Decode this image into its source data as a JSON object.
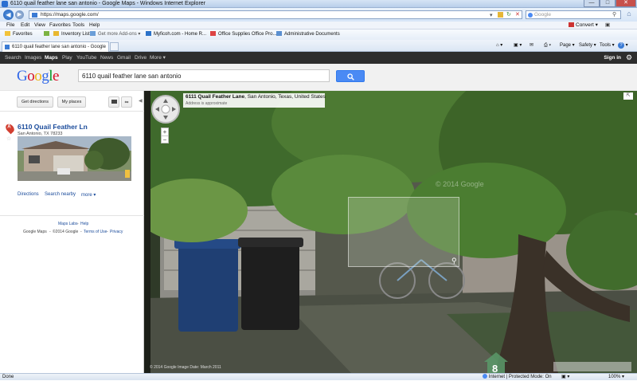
{
  "window": {
    "title": "6110 quail feather lane san antonio - Google Maps - Windows Internet Explorer"
  },
  "address_bar": {
    "url": "https://maps.google.com/",
    "search_placeholder": "Google",
    "convert_label": "Convert"
  },
  "menu": [
    "File",
    "Edit",
    "View",
    "Favorites",
    "Tools",
    "Help"
  ],
  "favorites_bar": {
    "favorites_label": "Favorites",
    "links": [
      "Inventory List",
      "Get more Add-ons",
      "Myficoh.com - Home R...",
      "Office Supplies Office Pro...",
      "Administrative Documents"
    ]
  },
  "tab": {
    "title": "6110 quail feather lane san antonio - Google Maps"
  },
  "command_bar": [
    "Page",
    "Safety",
    "Tools"
  ],
  "google_bar": {
    "items": [
      "Search",
      "Images",
      "Maps",
      "Play",
      "YouTube",
      "News",
      "Gmail",
      "Drive",
      "More"
    ],
    "active": "Maps",
    "signin": "Sign in"
  },
  "search": {
    "logo": "Google",
    "query": "6110 quail feather lane san antonio"
  },
  "left_panel": {
    "get_directions": "Get directions",
    "my_places": "My places",
    "result": {
      "marker": "A",
      "title": "6110 Quail Feather Ln",
      "address": "San Antonio, TX 78233"
    },
    "links": [
      "Directions",
      "Search nearby",
      "more"
    ],
    "footer_links": [
      "Maps Labs",
      "Help"
    ],
    "footer": {
      "prefix": "Google Maps",
      "copyright": "©2014 Google",
      "terms": "Terms of Use",
      "privacy": "Privacy"
    }
  },
  "street_view": {
    "address_main": "6111 Quail Feather Lane",
    "address_rest": ", San Antonio, Texas, United States",
    "approximate": "Address is approximate",
    "credits": "© 2014 Google     Image Date: March 2011",
    "watermark": "© 2014 Google"
  },
  "status_bar": {
    "left": "Done",
    "zone": "Internet | Protected Mode: On",
    "zoom": "100%"
  },
  "colors": {
    "link": "#1a4b9b",
    "google_bar": "#2d2d2d",
    "search_button": "#4a8af4"
  }
}
